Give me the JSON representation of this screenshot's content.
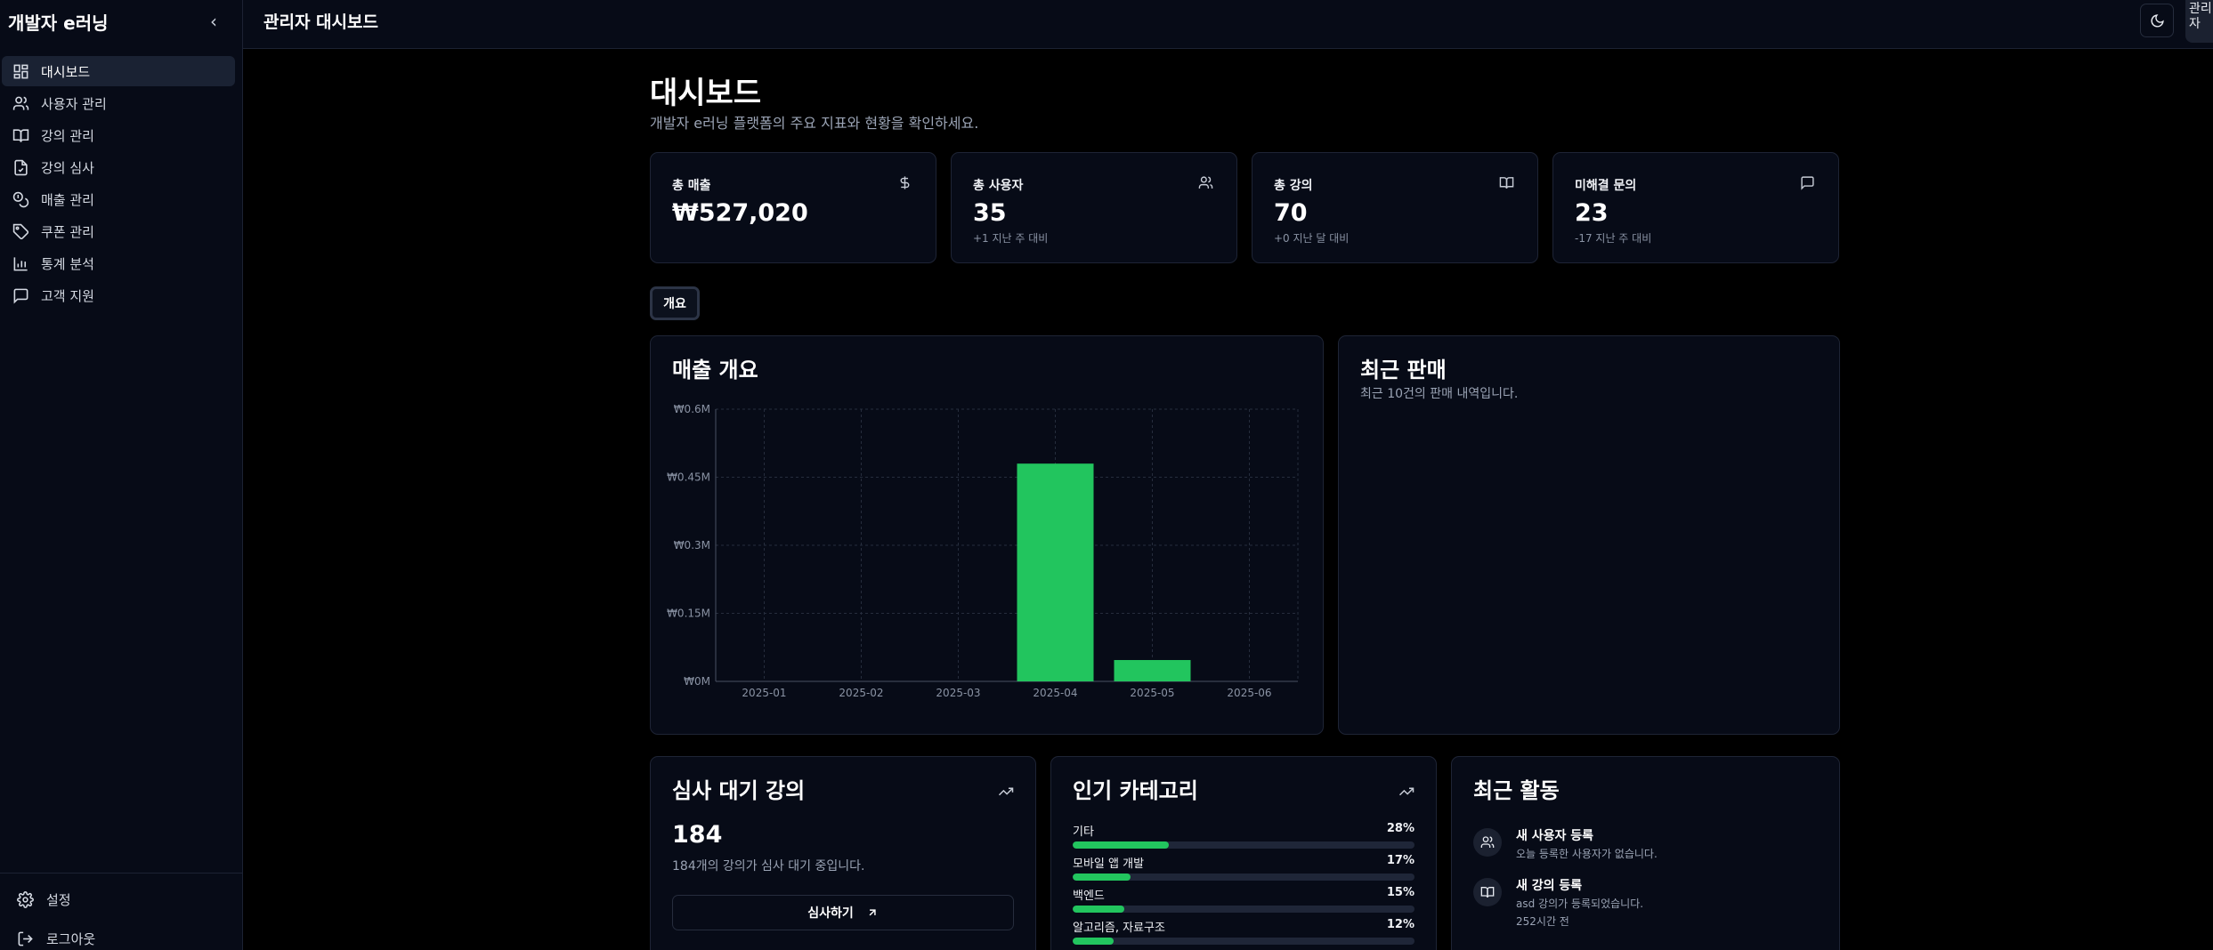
{
  "sidebar": {
    "brand": "개발자 e러닝",
    "collapse_icon": "‹",
    "items": [
      {
        "label": "대시보드",
        "icon": "dashboard-icon",
        "active": true
      },
      {
        "label": "사용자 관리",
        "icon": "users-icon"
      },
      {
        "label": "강의 관리",
        "icon": "book-icon"
      },
      {
        "label": "강의 심사",
        "icon": "file-check-icon"
      },
      {
        "label": "매출 관리",
        "icon": "coins-icon"
      },
      {
        "label": "쿠폰 관리",
        "icon": "tag-icon"
      },
      {
        "label": "통계 분석",
        "icon": "bar-chart-icon"
      },
      {
        "label": "고객 지원",
        "icon": "message-icon"
      }
    ],
    "footer": {
      "settings": "설정",
      "logout": "로그아웃"
    }
  },
  "header": {
    "title": "관리자 대시보드",
    "avatar_text": "관리자"
  },
  "page": {
    "title": "대시보드",
    "subtitle": "개발자 e러닝 플랫폼의 주요 지표와 현황을 확인하세요."
  },
  "stats": [
    {
      "label": "총 매출",
      "value": "₩527,020",
      "sub": "",
      "icon": "dollar-icon"
    },
    {
      "label": "총 사용자",
      "value": "35",
      "sub": "+1 지난 주 대비",
      "icon": "users-icon"
    },
    {
      "label": "총 강의",
      "value": "70",
      "sub": "+0 지난 달 대비",
      "icon": "book-icon"
    },
    {
      "label": "미해결 문의",
      "value": "23",
      "sub": "-17 지난 주 대비",
      "icon": "message-icon"
    }
  ],
  "tabs": {
    "overview": "개요"
  },
  "sales_overview": {
    "title": "매출 개요"
  },
  "recent_sales": {
    "title": "최근 판매",
    "description": "최근 10건의 판매 내역입니다."
  },
  "pending_review": {
    "title": "심사 대기 강의",
    "count": "184",
    "description": "184개의 강의가 심사 대기 중입니다.",
    "button": "심사하기"
  },
  "popular_categories": {
    "title": "인기 카테고리",
    "items": [
      {
        "name": "기타",
        "pct_label": "28%",
        "pct": 28
      },
      {
        "name": "모바일 앱 개발",
        "pct_label": "17%",
        "pct": 17
      },
      {
        "name": "백엔드",
        "pct_label": "15%",
        "pct": 15
      },
      {
        "name": "알고리즘, 자료구조",
        "pct_label": "12%",
        "pct": 12
      }
    ]
  },
  "recent_activity": {
    "title": "최근 활동",
    "items": [
      {
        "title": "새 사용자 등록",
        "desc": "오늘 등록한 사용자가 없습니다.",
        "time": "",
        "icon": "users-icon"
      },
      {
        "title": "새 강의 등록",
        "desc": "asd 강의가 등록되었습니다.",
        "time": "252시간 전",
        "icon": "book-icon"
      }
    ]
  },
  "colors": {
    "accent": "#22c55e",
    "background": "#000000",
    "card": "#070b17",
    "border": "#1e2435"
  },
  "chart_data": {
    "type": "bar",
    "categories": [
      "2025-01",
      "2025-02",
      "2025-03",
      "2025-04",
      "2025-05",
      "2025-06"
    ],
    "values": [
      0,
      0,
      0,
      480000,
      47020,
      0
    ],
    "y_ticks": [
      "₩0M",
      "₩0.15M",
      "₩0.3M",
      "₩0.45M",
      "₩0.6M"
    ],
    "ylim": [
      0,
      600000
    ],
    "grid": true,
    "color": "#22c55e"
  }
}
